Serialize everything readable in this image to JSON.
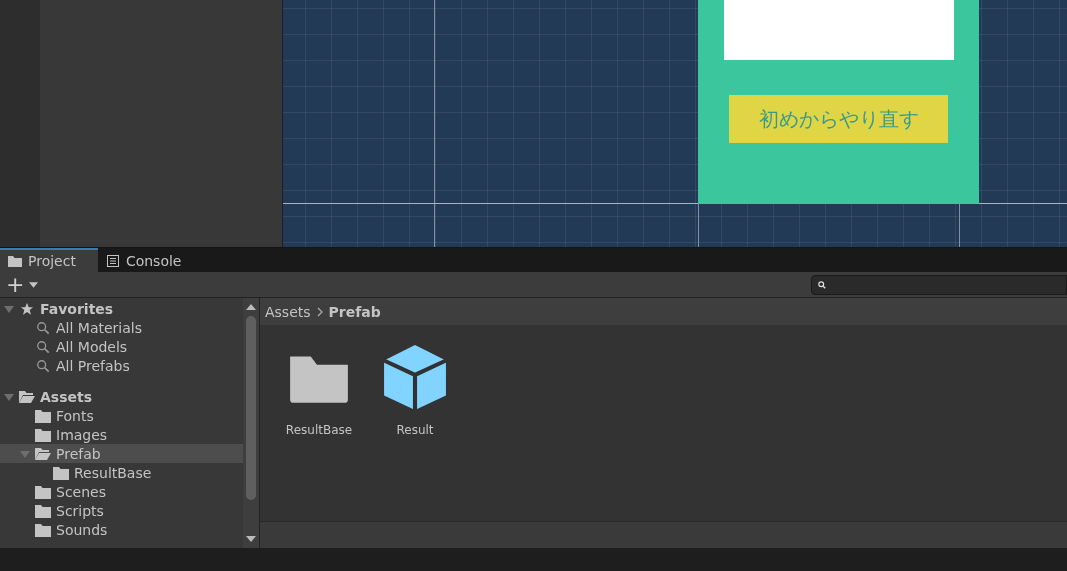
{
  "scene": {
    "restart_button": "初めからやり直す"
  },
  "tabs": [
    {
      "label": "Project",
      "kind": "folder",
      "selected": true
    },
    {
      "label": "Console",
      "kind": "list",
      "selected": false
    }
  ],
  "toolbar": {
    "add": "+"
  },
  "tree": [
    {
      "label": "Favorites",
      "kind": "favorites",
      "expanded": true,
      "selected": false,
      "children": [
        {
          "label": "All Materials",
          "kind": "search",
          "selected": false
        },
        {
          "label": "All Models",
          "kind": "search",
          "selected": false
        },
        {
          "label": "All Prefabs",
          "kind": "search",
          "selected": false
        }
      ]
    },
    {
      "label": "Assets",
      "kind": "folder",
      "expanded": true,
      "selected": false,
      "children": [
        {
          "label": "Fonts",
          "kind": "folder",
          "selected": false
        },
        {
          "label": "Images",
          "kind": "folder",
          "selected": false
        },
        {
          "label": "Prefab",
          "kind": "folder",
          "expanded": true,
          "selected": true,
          "children": [
            {
              "label": "ResultBase",
              "kind": "folder",
              "selected": false
            }
          ]
        },
        {
          "label": "Scenes",
          "kind": "folder",
          "selected": false
        },
        {
          "label": "Scripts",
          "kind": "folder",
          "selected": false
        },
        {
          "label": "Sounds",
          "kind": "folder",
          "selected": false
        }
      ]
    }
  ],
  "breadcrumb": [
    "Assets",
    "Prefab"
  ],
  "assets": [
    {
      "label": "ResultBase",
      "kind": "folder"
    },
    {
      "label": "Result",
      "kind": "prefab"
    }
  ]
}
